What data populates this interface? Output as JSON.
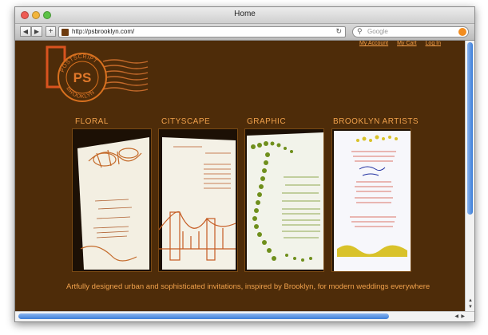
{
  "window": {
    "title": "Home"
  },
  "toolbar": {
    "back": "◀",
    "forward": "▶",
    "add": "+",
    "url": "http://psbrooklyn.com/",
    "reload": "↻",
    "search_placeholder": "Google",
    "search_icon": "search-icon",
    "go_icon": "snapback-icon"
  },
  "nav": {
    "account": "My Account",
    "cart": "My Cart",
    "login": "Log In"
  },
  "logo": {
    "top_text": "POSTSCRIPT",
    "bottom_text": "BROOKLYN",
    "initials": "PS"
  },
  "categories": [
    {
      "label": "FLORAL",
      "accent": "#c46a2a"
    },
    {
      "label": "CITYSCAPE",
      "accent": "#c55b22"
    },
    {
      "label": "GRAPHIC",
      "accent": "#6f8f1c"
    },
    {
      "label": "BROOKLYN ARTISTS",
      "accent": "#d9c22a"
    }
  ],
  "tagline": "Artfully designed urban and sophisticated invitations, inspired by Brooklyn, for modern weddings everywhere",
  "colors": {
    "page_bg": "#4e2c09",
    "accent_orange": "#f0a14c",
    "link": "#f5a04a"
  }
}
